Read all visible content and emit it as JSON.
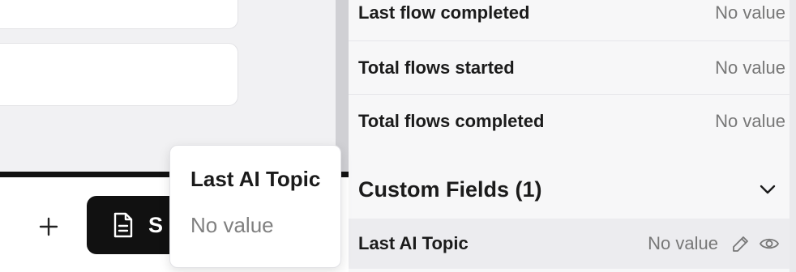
{
  "contact_details": {
    "rows": [
      {
        "label": "Last flow completed",
        "value": "No value"
      },
      {
        "label": "Total flows started",
        "value": "No value"
      },
      {
        "label": "Total flows completed",
        "value": "No value"
      }
    ]
  },
  "custom_fields": {
    "title": "Custom Fields (1)",
    "expand_icon": "chevron-down-icon",
    "fields": [
      {
        "label": "Last AI Topic",
        "value": "No value",
        "edit_icon": "pencil-icon",
        "view_icon": "eye-icon"
      }
    ]
  },
  "popover": {
    "title": "Last AI Topic",
    "value": "No value"
  },
  "composer": {
    "add_icon": "plus-icon",
    "doc_button_icon": "document-icon",
    "doc_button_label_visible": "S"
  }
}
